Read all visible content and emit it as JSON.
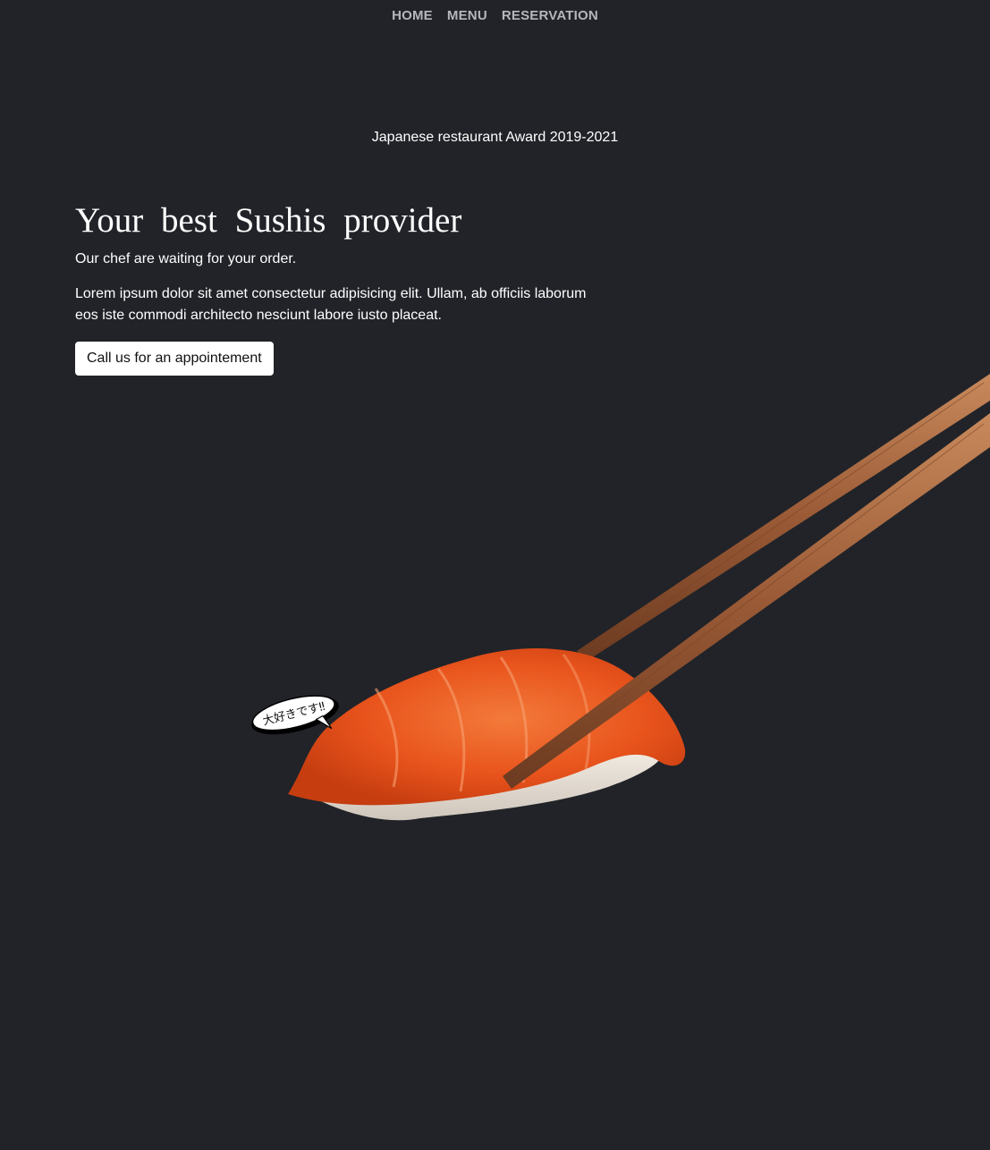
{
  "nav": {
    "items": [
      {
        "label": "HOME"
      },
      {
        "label": "MENU"
      },
      {
        "label": "RESERVATION"
      }
    ]
  },
  "award": {
    "text": "Japanese restaurant Award 2019-2021"
  },
  "hero": {
    "title": "Your best Sushis provider",
    "tagline": "Our chef are waiting for your order.",
    "description": "Lorem ipsum dolor sit amet consectetur adipisicing elit. Ullam, ab officiis laborum eos iste commodi architecto nesciunt labore iusto placeat.",
    "cta_label": "Call us for an appointement"
  },
  "illustration": {
    "speech_bubble_text": "大好きです‼"
  },
  "colors": {
    "background": "#212328",
    "nav_text": "#b5b7bb",
    "button_bg": "#ffffff",
    "salmon": "#e8531c",
    "chopstick": "#9a5a36"
  }
}
